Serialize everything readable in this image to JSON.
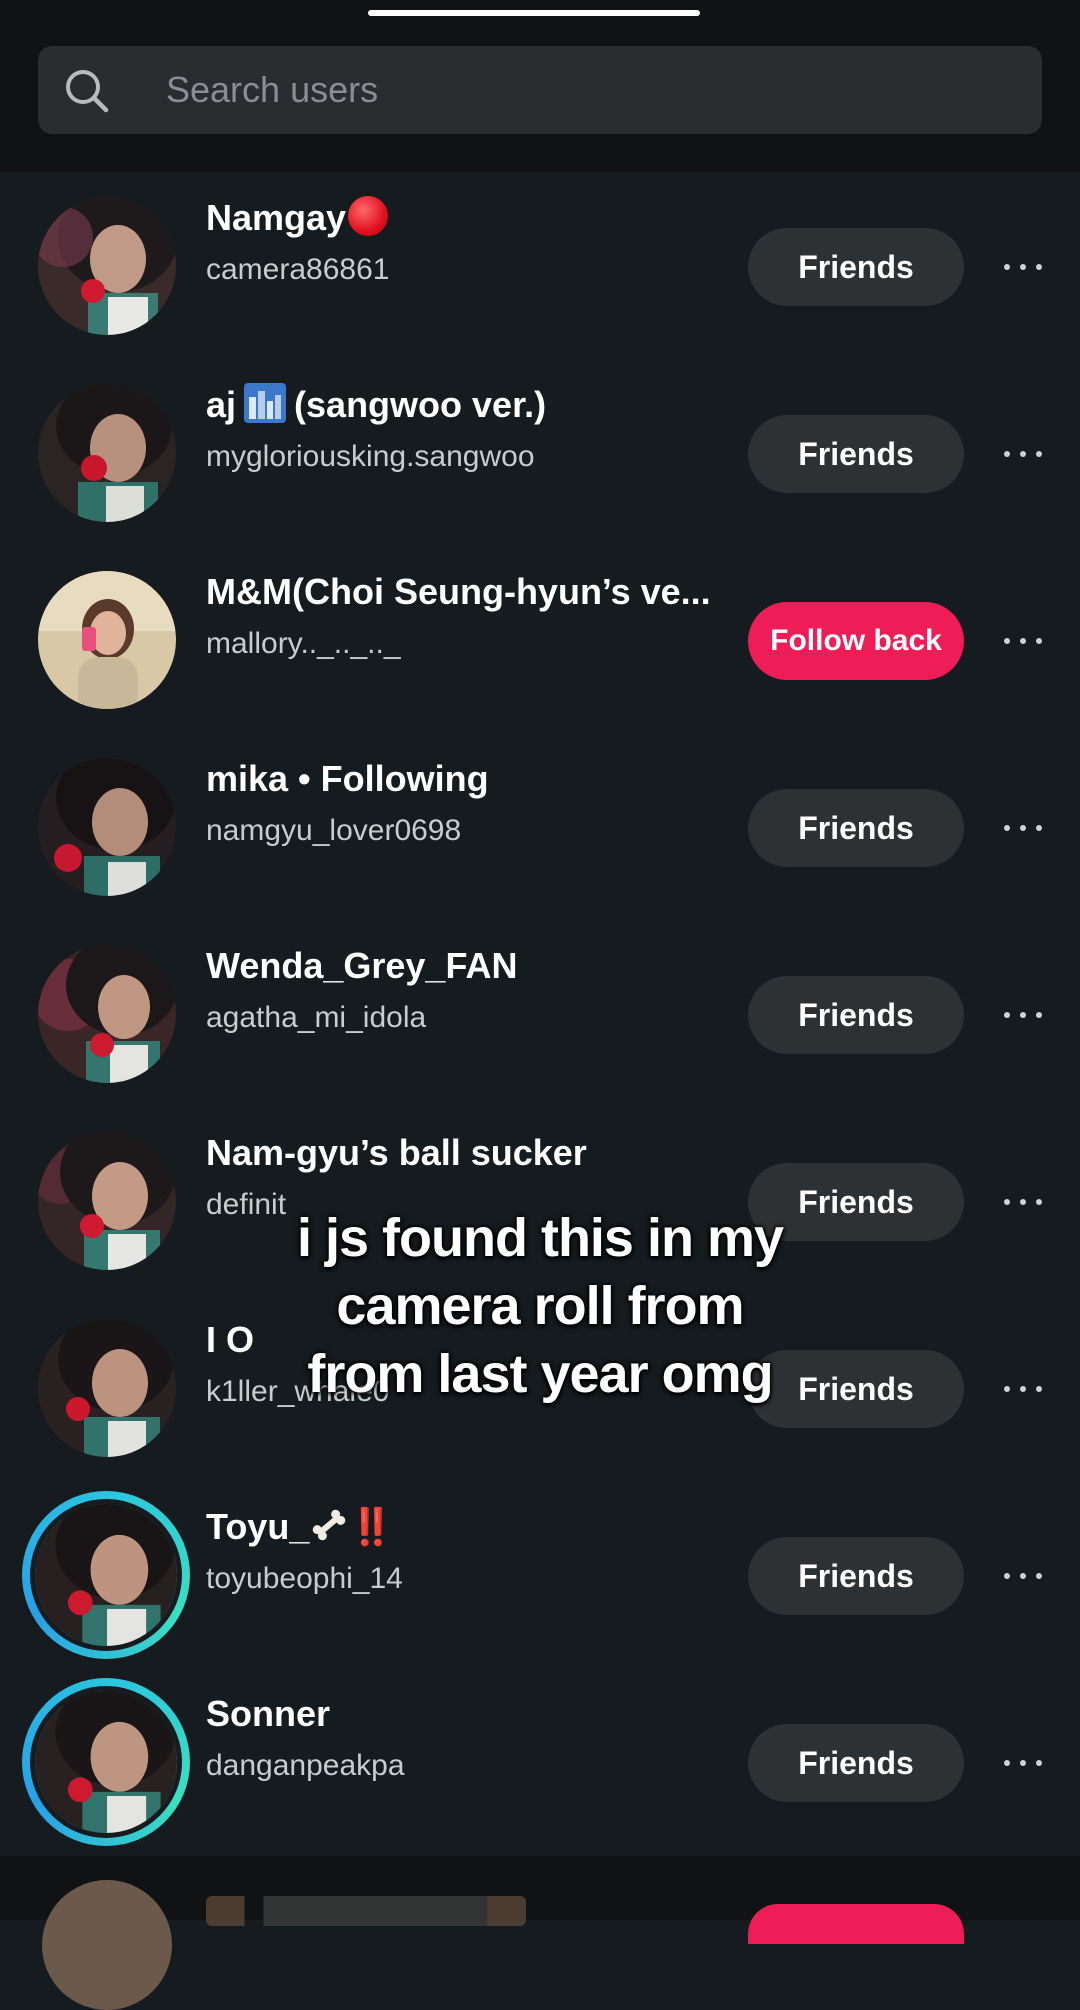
{
  "search": {
    "placeholder": "Search users",
    "icon": "search-icon"
  },
  "users": [
    {
      "name": "Namgay",
      "suffix": "red-circle-emoji",
      "handle": "camera86861",
      "button": "Friends",
      "button_style": "secondary"
    },
    {
      "name_pre": "aj",
      "suffix": "cityscape-emoji",
      "name_post": "(sangwoo ver.)",
      "handle": "mygloriousking.sangwoo",
      "button": "Friends",
      "button_style": "secondary"
    },
    {
      "name": "M&M(Choi Seung-hyun’s ve...",
      "handle": "mallory.._.._.._",
      "button": "Follow back",
      "button_style": "primary"
    },
    {
      "name": "mika • Following",
      "handle": "namgyu_lover0698",
      "button": "Friends",
      "button_style": "secondary"
    },
    {
      "name": "Wenda_Grey_FAN",
      "handle": "agatha_mi_idola",
      "button": "Friends",
      "button_style": "secondary"
    },
    {
      "name": "Nam-gyu’s ball sucker",
      "handle": "definit",
      "button": "Friends",
      "button_style": "secondary"
    },
    {
      "name": "I O",
      "handle": "k1ller_whale0",
      "button": "Friends",
      "button_style": "secondary"
    },
    {
      "name_pre": "Toyu_",
      "suffix": "bone-emoji",
      "name_post": "‼️",
      "handle": "toyubeophi_14",
      "button": "Friends",
      "button_style": "secondary",
      "story_ring": true
    },
    {
      "name": "Sonner",
      "handle": "danganpeakpa",
      "button": "Friends",
      "button_style": "secondary",
      "story_ring": true
    }
  ],
  "caption": {
    "line1": "i js found this in my",
    "line2": "camera roll from",
    "line3": "from last year omg"
  },
  "colors": {
    "background": "#151b1f",
    "follow_back": "#ef1d57",
    "friends_button": "#2d3134",
    "story_ring": "#2bc4e0"
  }
}
